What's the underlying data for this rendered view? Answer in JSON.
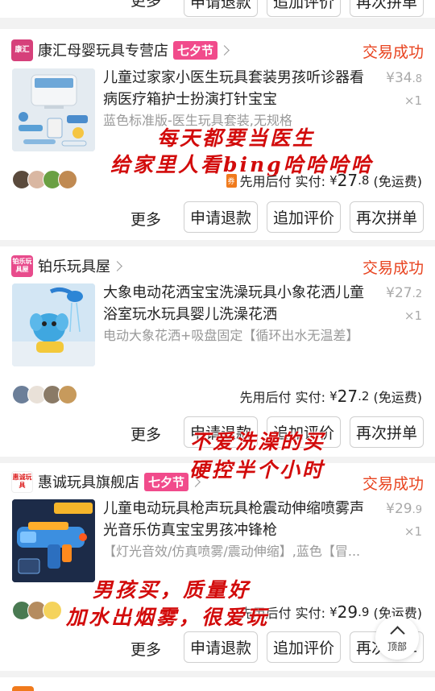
{
  "top_partial": {
    "more": "更多",
    "buttons": [
      "申请退款",
      "追加评价",
      "再次拼单"
    ]
  },
  "orders": [
    {
      "store_logo": "康汇",
      "store": "康汇母婴玩具专营店",
      "tag": "七夕节",
      "status": "交易成功",
      "title": "儿童过家家小医生玩具套装男孩听诊器看病医疗箱护士扮演打针宝宝",
      "spec": "蓝色标准版-医生玩具套装,无规格",
      "price_main": "34",
      "price_dec": ".8",
      "qty": "×1",
      "pay_badge": "先用后付",
      "paid_label": "先用后付 实付:",
      "paid_currency": "¥",
      "paid_main": "27",
      "paid_dec": ".8",
      "paid_note": "(免运费)",
      "more": "更多",
      "buttons": [
        "申请退款",
        "追加评价",
        "再次拼单"
      ],
      "handwriting": [
        "每天都要当医生",
        "给家里人看bing哈哈哈哈"
      ]
    },
    {
      "store_logo": "铂乐玩具屋",
      "store": "铂乐玩具屋",
      "status": "交易成功",
      "title": "大象电动花洒宝宝洗澡玩具小象花洒儿童浴室玩水玩具婴儿洗澡花洒",
      "spec": "电动大象花洒+吸盘固定【循环出水无温差】",
      "price_main": "27",
      "price_dec": ".2",
      "qty": "×1",
      "paid_label": "先用后付 实付:",
      "paid_currency": "¥",
      "paid_main": "27",
      "paid_dec": ".2",
      "paid_note": "(免运费)",
      "more": "更多",
      "buttons": [
        "申请退款",
        "追加评价",
        "再次拼单"
      ],
      "handwriting": [
        "不爱洗澡的买",
        "硬控半个小时"
      ]
    },
    {
      "store_logo": "惠诚玩具",
      "store": "惠诚玩具旗舰店",
      "tag": "七夕节",
      "status": "交易成功",
      "title": "儿童电动玩具枪声玩具枪震动伸缩喷雾声光音乐仿真宝宝男孩冲锋枪",
      "spec": "【灯光音效/仿真喷雾/震动伸缩】,蓝色【冒...",
      "price_main": "29",
      "price_dec": ".9",
      "qty": "×1",
      "paid_label": "先用后付 实付:",
      "paid_currency": "¥",
      "paid_main": "29",
      "paid_dec": ".9",
      "paid_note": "(免运费)",
      "more": "更多",
      "buttons": [
        "申请退款",
        "追加评价",
        "再次拼单"
      ],
      "handwriting": [
        "男孩买，质量好",
        "加水出烟雾，很爱玩"
      ]
    }
  ],
  "back_to_top": "顶部",
  "colors": {
    "status": "#e8431f",
    "tag": "#f14b8b",
    "handwriting": "#d20b0b"
  }
}
